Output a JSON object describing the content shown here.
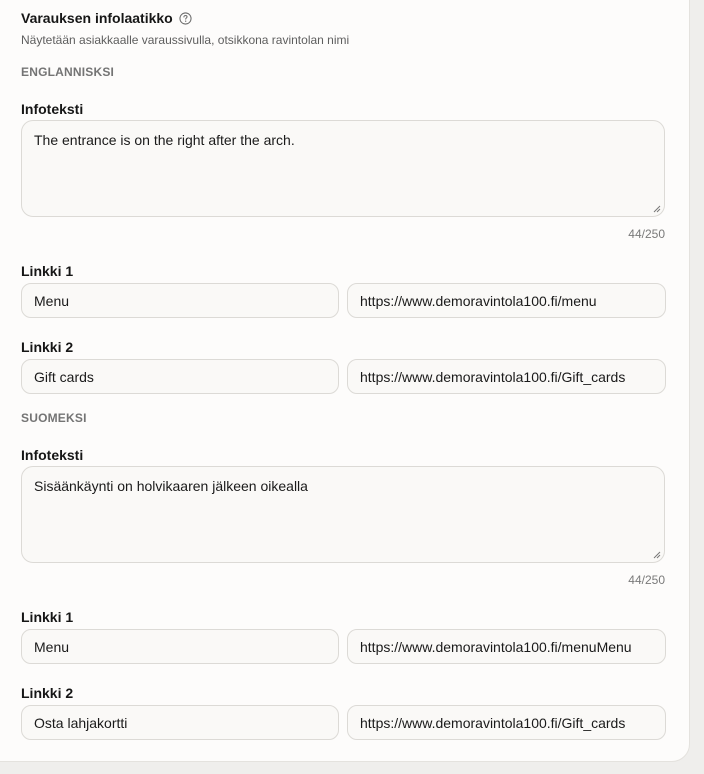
{
  "header": {
    "title": "Varauksen infolaatikko",
    "subtitle": "Näytetään asiakkaalle varaussivulla, otsikkona ravintolan nimi"
  },
  "english": {
    "section_label": "ENGLANNISKSI",
    "info_label": "Infoteksti",
    "info_text": "The entrance is on the right after the arch.",
    "counter": "44/250",
    "link1": {
      "label": "Linkki 1",
      "text": "Menu",
      "url": "https://www.demoravintola100.fi/menu"
    },
    "link2": {
      "label": "Linkki 2",
      "text": "Gift cards",
      "url": "https://www.demoravintola100.fi/Gift_cards"
    }
  },
  "finnish": {
    "section_label": "SUOMEKSI",
    "info_label": "Infoteksti",
    "info_text": "Sisäänkäynti on holvikaaren jälkeen oikealla",
    "counter": "44/250",
    "link1": {
      "label": "Linkki 1",
      "text": "Menu",
      "url": "https://www.demoravintola100.fi/menuMenu"
    },
    "link2": {
      "label": "Linkki 2",
      "text": "Osta lahjakortti",
      "url": "https://www.demoravintola100.fi/Gift_cards"
    }
  },
  "icons": {
    "help": "help-circle-icon",
    "resize": "resize-handle-icon"
  }
}
